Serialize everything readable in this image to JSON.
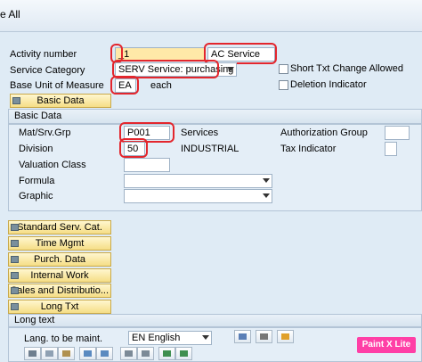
{
  "window": {
    "title": "e All"
  },
  "header": {
    "activity_number_label": "Activity number",
    "activity_number_value": "_1",
    "activity_description": "AC Service",
    "service_category_label": "Service Category",
    "service_category_value": "SERV Service: purchasing",
    "base_unit_label": "Base Unit of Measure",
    "base_unit_value": "EA",
    "base_unit_text": "each",
    "short_txt_label": "Short Txt Change Allowed",
    "deletion_label": "Deletion Indicator"
  },
  "basic_data_button": "Basic Data",
  "basic_data_section": {
    "title": "Basic Data",
    "mat_srv_grp_label": "Mat/Srv.Grp",
    "mat_srv_grp_value": "P001",
    "mat_srv_grp_text": "Services",
    "auth_group_label": "Authorization Group",
    "division_label": "Division",
    "division_value": "50",
    "division_text": "INDUSTRIAL",
    "tax_indicator_label": "Tax Indicator",
    "valuation_class_label": "Valuation Class",
    "formula_label": "Formula",
    "graphic_label": "Graphic"
  },
  "tab_buttons": [
    "Standard Serv. Cat.",
    "Time Mgmt",
    "Purch. Data",
    "Internal Work",
    "Sales and Distributio...",
    "Long Txt"
  ],
  "long_text": {
    "title": "Long text",
    "lang_label": "Lang. to be maint.",
    "lang_value": "EN English"
  },
  "watermark": "Paint X Lite",
  "colors": {
    "background": "#dfebf5",
    "highlight_box": "#e3262d",
    "button_fill": "#f5dd86",
    "required_field": "#ffe9a8"
  }
}
